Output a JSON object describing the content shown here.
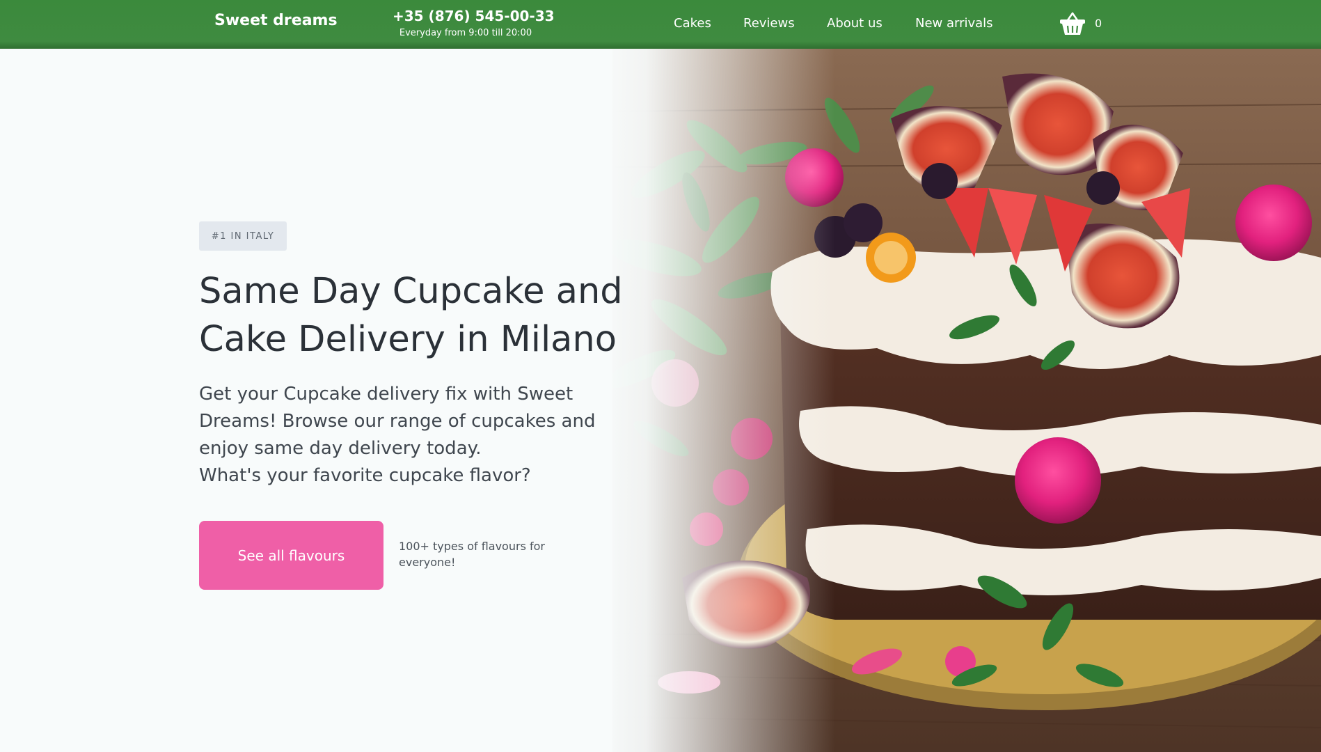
{
  "header": {
    "brand": "Sweet dreams",
    "phone": "+35 (876) 545-00-33",
    "hours": "Everyday from 9:00 till 20:00",
    "nav": [
      {
        "label": "Cakes"
      },
      {
        "label": "Reviews"
      },
      {
        "label": "About us"
      },
      {
        "label": "New arrivals"
      }
    ],
    "cart_icon": "basket-icon",
    "cart_count": "0"
  },
  "hero": {
    "badge": "#1 IN ITALY",
    "title_lines": [
      "Same Day Cupcake and",
      "Cake Delivery in Milano"
    ],
    "description_lines": [
      "Get your Cupcake delivery fix with Sweet",
      "Dreams! Browse our range of cupcakes and",
      "enjoy same day delivery today.",
      "What's your favorite cupcake flavor?"
    ],
    "cta_label": "See all flavours",
    "cta_note": "100+ types of flavours for everyone!",
    "image_subject": "layered-naked-cake-with-figs-berries-roses"
  },
  "colors": {
    "header_green": "#3f8b40",
    "cta_pink": "#ef5fa7",
    "badge_bg": "#e3e8ee",
    "page_bg": "#f8fbfb",
    "title_text": "#2b3138"
  }
}
